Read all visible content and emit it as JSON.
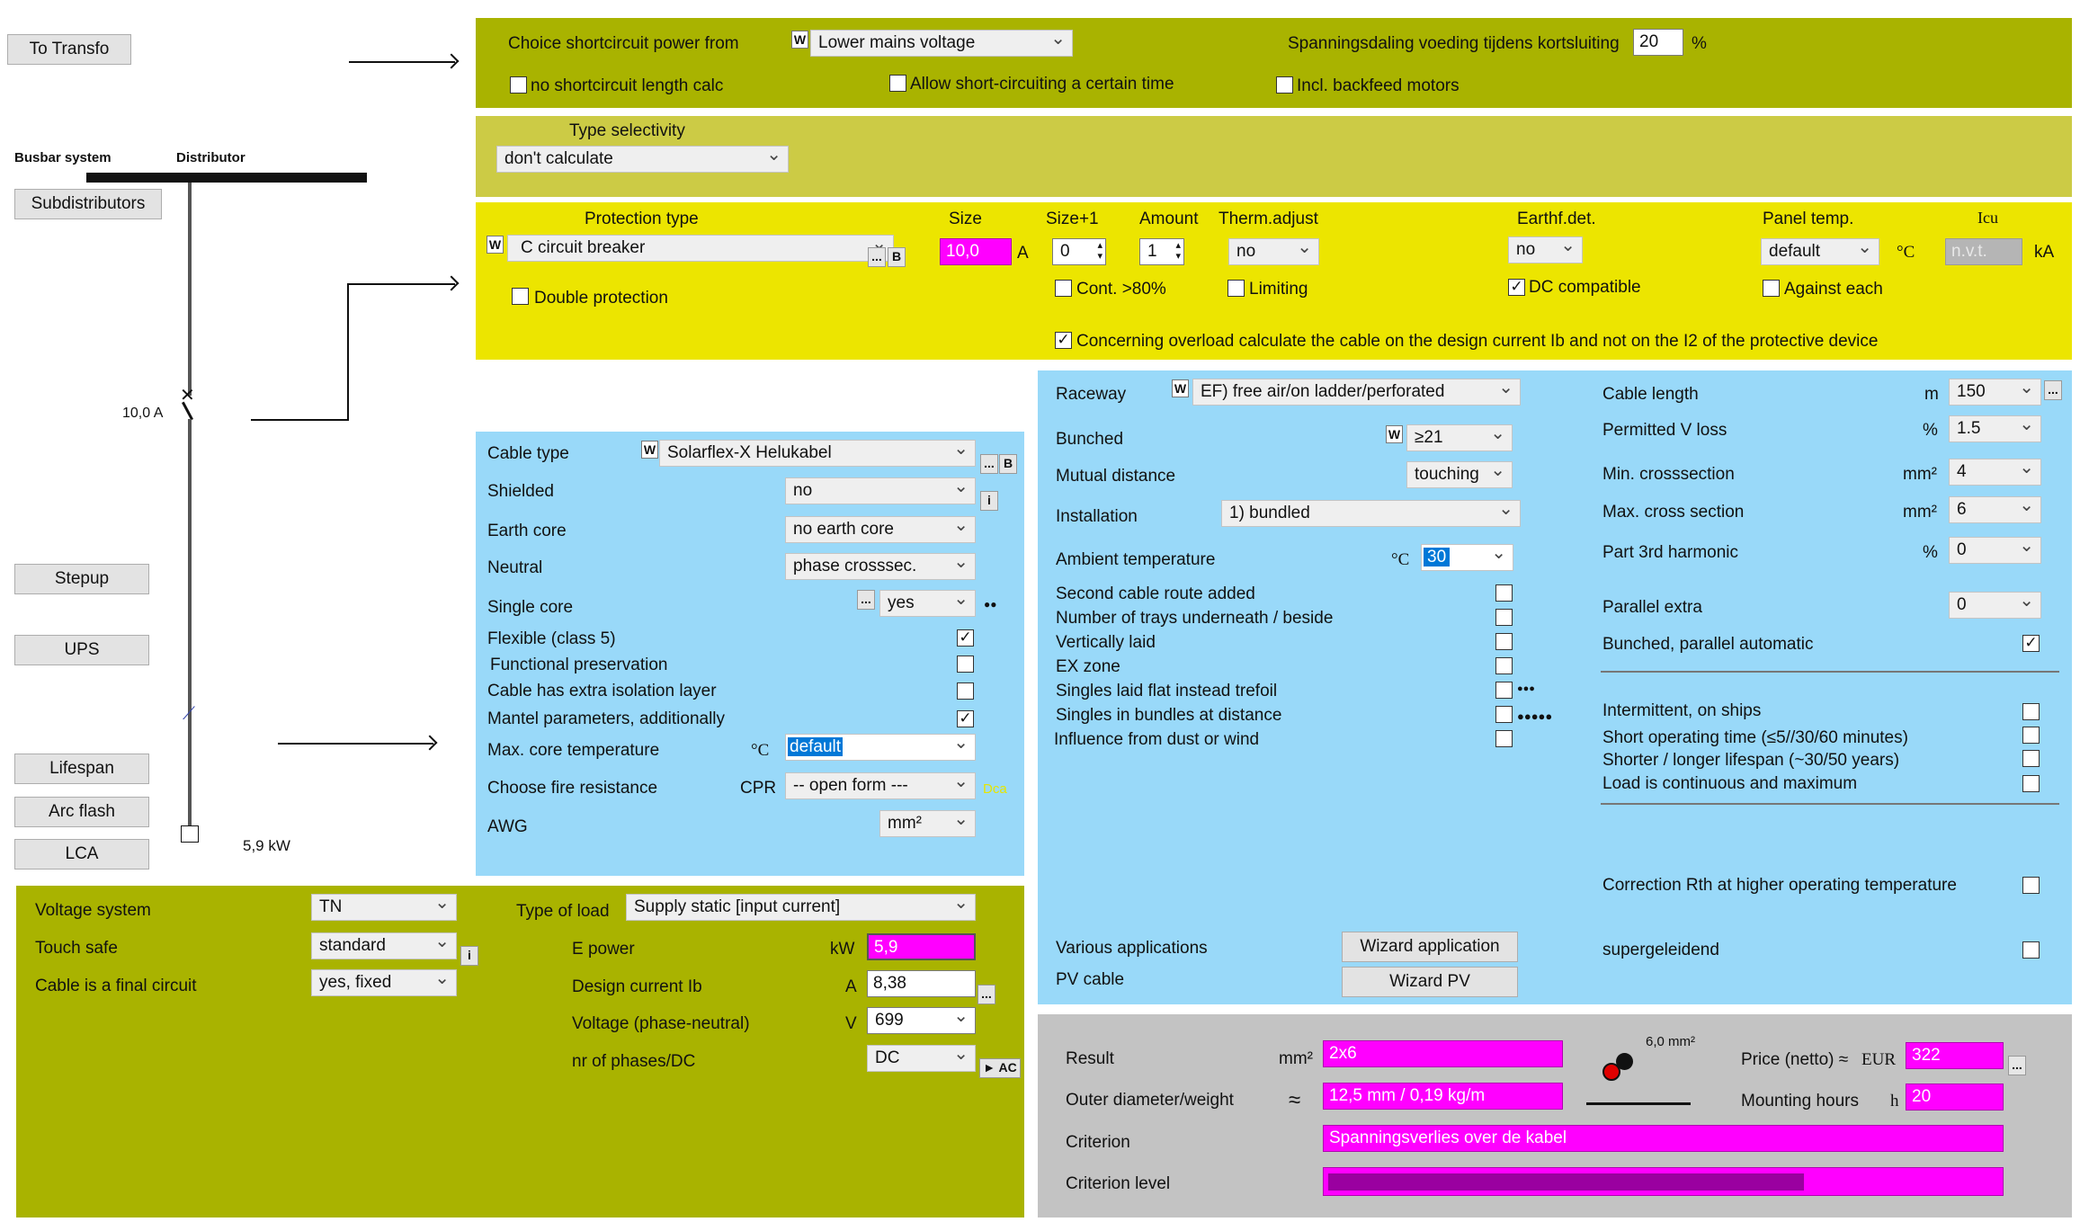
{
  "left": {
    "to_transfo": "To Transfo",
    "busbar_system": "Busbar system",
    "distributor": "Distributor",
    "subdistributors": "Subdistributors",
    "fuse_label": "10,0 A",
    "stepup": "Stepup",
    "ups": "UPS",
    "lifespan": "Lifespan",
    "arc_flash": "Arc flash",
    "lca": "LCA",
    "load_power": "5,9 kW"
  },
  "shortcircuit": {
    "choice_label": "Choice shortcircuit power from",
    "choice_value": "Lower mains voltage",
    "voltage_drop_label": "Spanningsdaling voeding tijdens kortsluiting",
    "voltage_drop_value": "20",
    "voltage_drop_unit": "%",
    "no_length_calc": "no shortcircuit length calc",
    "allow_time": "Allow short-circuiting a certain time",
    "backfeed": "Incl. backfeed motors"
  },
  "selectivity": {
    "label": "Type selectivity",
    "value": "don't calculate"
  },
  "protection": {
    "type_header": "Protection type",
    "type_value": "C circuit breaker",
    "size_header": "Size",
    "size_value": "10,0",
    "size_unit": "A",
    "size_plus_header": "Size+1",
    "size_plus_value": "0",
    "amount_header": "Amount",
    "amount_value": "1",
    "therm_header": "Therm.adjust",
    "therm_value": "no",
    "earthf_header": "Earthf.det.",
    "earthf_value": "no",
    "panel_temp_header": "Panel temp.",
    "panel_temp_value": "default",
    "panel_temp_unit": "°C",
    "icu_header": "Icu",
    "icu_value": "n.v.t.",
    "icu_unit": "kA",
    "double_protection": "Double protection",
    "cont_80": "Cont. >80%",
    "limiting": "Limiting",
    "dc_compatible": "DC compatible",
    "against_each": "Against each",
    "overload_note": "Concerning overload calculate the cable on the design current Ib and not on the I2 of the protective device"
  },
  "cable": {
    "cable_type_label": "Cable type",
    "cable_type_value": "Solarflex-X Helukabel",
    "shielded_label": "Shielded",
    "shielded_value": "no",
    "earth_core_label": "Earth core",
    "earth_core_value": "no earth core",
    "neutral_label": "Neutral",
    "neutral_value": "phase crosssec.",
    "single_core_label": "Single core",
    "single_core_value": "yes",
    "flexible_label": "Flexible (class 5)",
    "functional_label": "Functional preservation",
    "extra_isolation_label": "Cable has extra isolation layer",
    "mantel_label": "Mantel parameters, additionally",
    "max_core_temp_label": "Max. core temperature",
    "max_core_temp_unit": "°C",
    "max_core_temp_value": "default",
    "fire_label": "Choose fire resistance",
    "fire_cpr": "CPR",
    "fire_value": "-- open form ---",
    "fire_class": "Dca",
    "awg_label": "AWG",
    "awg_value": "mm²"
  },
  "raceway": {
    "raceway_label": "Raceway",
    "raceway_value": "EF) free air/on ladder/perforated",
    "bunched_label": "Bunched",
    "bunched_value": "≥21",
    "mutual_label": "Mutual distance",
    "mutual_value": "touching",
    "installation_label": "Installation",
    "installation_value": "1) bundled",
    "ambient_label": "Ambient temperature",
    "ambient_unit": "°C",
    "ambient_value": "30",
    "second_route": "Second cable route added",
    "trays": "Number of trays underneath / beside",
    "vertically": "Vertically laid",
    "ex_zone": "EX zone",
    "singles_flat": "Singles laid flat instead trefoil",
    "singles_bundles": "Singles in bundles at distance",
    "dust_wind": "Influence from dust or wind",
    "various_label": "Various applications",
    "wizard_app": "Wizard application",
    "pv_label": "PV cable",
    "wizard_pv": "Wizard PV"
  },
  "length": {
    "cable_length_label": "Cable length",
    "cable_length_unit": "m",
    "cable_length_value": "150",
    "vloss_label": "Permitted V loss",
    "vloss_unit": "%",
    "vloss_value": "1.5",
    "min_cs_label": "Min. crosssection",
    "min_cs_unit": "mm²",
    "min_cs_value": "4",
    "max_cs_label": "Max. cross section",
    "max_cs_unit": "mm²",
    "max_cs_value": "6",
    "harmonic_label": "Part 3rd harmonic",
    "harmonic_unit": "%",
    "harmonic_value": "0",
    "parallel_label": "Parallel extra",
    "parallel_value": "0",
    "bunched_parallel": "Bunched, parallel automatic",
    "intermittent": "Intermittent, on ships",
    "short_operating": "Short operating time (≤5//30/60 minutes)",
    "lifespan": "Shorter / longer lifespan (~30/50 years)",
    "continuous": "Load is continuous and maximum",
    "correction_rth": "Correction Rth at higher operating temperature",
    "supergeleidend": "supergeleidend"
  },
  "supply": {
    "voltage_system_label": "Voltage system",
    "voltage_system_value": "TN",
    "touch_safe_label": "Touch safe",
    "touch_safe_value": "standard",
    "final_circuit_label": "Cable is a final circuit",
    "final_circuit_value": "yes, fixed",
    "load_type_label": "Type of load",
    "load_type_value": "Supply static [input current]",
    "e_power_label": "E power",
    "e_power_unit": "kW",
    "e_power_value": "5,9",
    "design_current_label": "Design current Ib",
    "design_current_unit": "A",
    "design_current_value": "8,38",
    "voltage_label": "Voltage (phase-neutral)",
    "voltage_unit": "V",
    "voltage_value": "699",
    "phases_label": "nr of phases/DC",
    "phases_value": "DC",
    "ac_button": "► AC"
  },
  "result": {
    "result_label": "Result",
    "result_unit": "mm²",
    "result_value": "2x6",
    "diagram_label": "6,0 mm²",
    "outer_label": "Outer diameter/weight",
    "outer_symbol": "≈",
    "outer_value": "12,5 mm / 0,19 kg/m",
    "criterion_label": "Criterion",
    "criterion_value": "Spanningsverlies over de kabel",
    "criterion_level_label": "Criterion level",
    "criterion_level": 0.71,
    "price_label": "Price (netto) ≈",
    "price_unit": "EUR",
    "price_value": "322",
    "hours_label": "Mounting hours",
    "hours_unit": "h",
    "hours_value": "20"
  },
  "colors": {
    "olive": "#a9b300",
    "mustard": "#cccb45",
    "yellow": "#ece500",
    "blue": "#99d9f9",
    "gray": "#c3c3c3",
    "magenta": "#ff00ff",
    "bar_fill": "#9a00a0"
  }
}
